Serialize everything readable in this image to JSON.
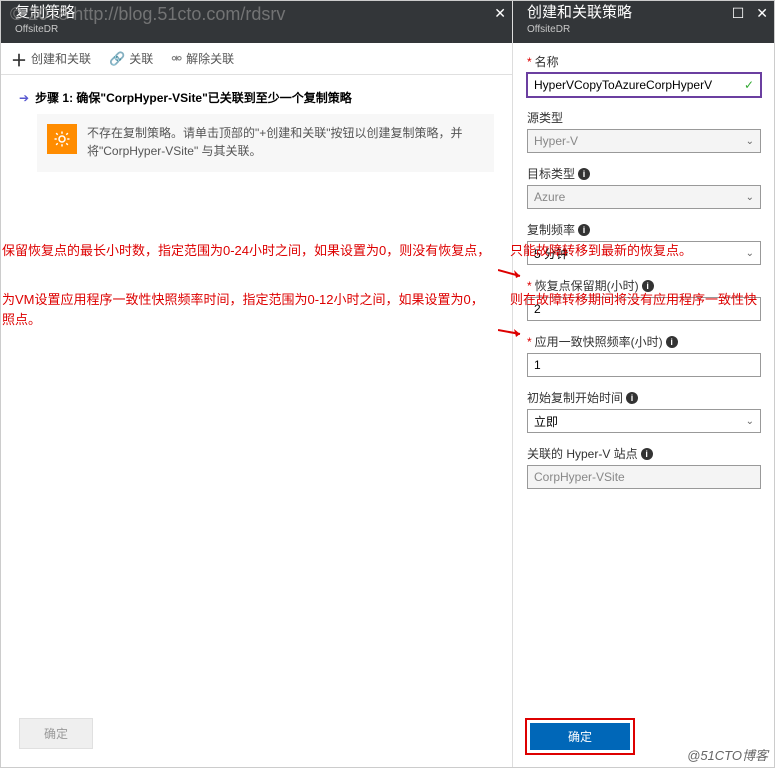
{
  "watermark": {
    "topLeft": "© 2018 http://blog.51cto.com/rdsrv",
    "bottomRight": "@51CTO博客"
  },
  "leftPanel": {
    "title": "复制策略",
    "subtitle": "OffsiteDR",
    "toolbar": {
      "add": "创建和关联",
      "link": "关联",
      "unlink": "解除关联"
    },
    "step": "步骤 1: 确保\"CorpHyper-VSite\"已关联到至少一个复制策略",
    "infoText": "不存在复制策略。请单击顶部的\"+创建和关联\"按钮以创建复制策略，并将\"CorpHyper-VSite\" 与其关联。",
    "okLabel": "确定"
  },
  "annotations": {
    "a1": "保留恢复点的最长小时数，指定范围为0-24小时之间，如果设置为0，则没有恢复点，",
    "a1b": "只能故障转移到最新的恢复点。",
    "a2": "为VM设置应用程序一致性快照频率时间，指定范围为0-12小时之间，如果设置为0，",
    "a2b": "则在故障转移期间将没有应用程序一致性快",
    "a2c": "照点。"
  },
  "rightPanel": {
    "title": "创建和关联策略",
    "subtitle": "OffsiteDR",
    "fields": {
      "name": {
        "label": "名称",
        "value": "HyperVCopyToAzureCorpHyperV"
      },
      "sourceType": {
        "label": "源类型",
        "value": "Hyper-V"
      },
      "targetType": {
        "label": "目标类型",
        "value": "Azure"
      },
      "copyFreq": {
        "label": "复制频率",
        "value": "5 分钟"
      },
      "retention": {
        "label": "恢复点保留期(小时)",
        "value": "2"
      },
      "appSnap": {
        "label": "应用一致快照频率(小时)",
        "value": "1"
      },
      "initTime": {
        "label": "初始复制开始时间",
        "value": "立即"
      },
      "assocSite": {
        "label": "关联的 Hyper-V 站点",
        "value": "CorpHyper-VSite"
      }
    },
    "okLabel": "确定"
  }
}
